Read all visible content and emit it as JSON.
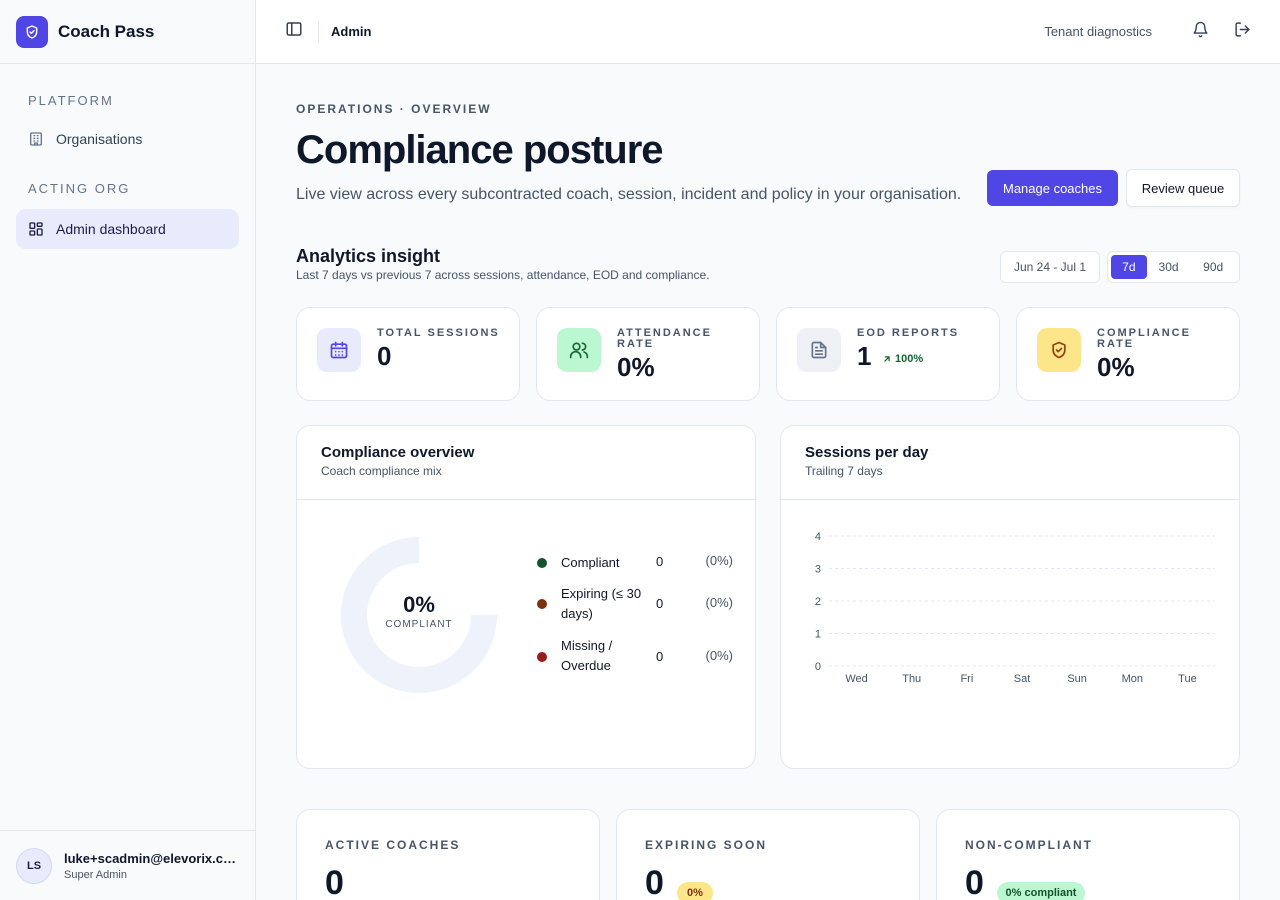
{
  "app": {
    "name": "Coach Pass"
  },
  "sidebar": {
    "platform_heading": "PLATFORM",
    "platform_items": [
      {
        "label": "Organisations",
        "icon": "building-icon"
      }
    ],
    "acting_org_heading": "ACTING ORG",
    "acting_org_items": [
      {
        "label": "Admin dashboard",
        "icon": "grid-icon",
        "active": true
      }
    ],
    "user": {
      "initials": "LS",
      "email": "luke+scadmin@elevorix.co.uk",
      "role": "Super Admin"
    }
  },
  "topbar": {
    "breadcrumb": "Admin",
    "diagnostics_link": "Tenant diagnostics"
  },
  "header": {
    "eyebrow": "OPERATIONS · OVERVIEW",
    "title": "Compliance posture",
    "subtitle": "Live view across every subcontracted coach, session, incident and policy in your organisation.",
    "primary_action": "Manage coaches",
    "secondary_action": "Review queue"
  },
  "analytics": {
    "title": "Analytics insight",
    "subtitle": "Last 7 days vs previous 7 across sessions, attendance, EOD and compliance.",
    "date_range": "Jun 24 - Jul 1",
    "ranges": [
      "7d",
      "30d",
      "90d"
    ],
    "selected_range": "7d"
  },
  "kpis": [
    {
      "label": "TOTAL SESSIONS",
      "value": "0",
      "icon": "calendar-icon",
      "icon_bg": "#e8ebfb",
      "icon_color": "#4f46e5"
    },
    {
      "label": "ATTENDANCE RATE",
      "value": "0%",
      "icon": "users-icon",
      "icon_bg": "#bbf7d0",
      "icon_color": "#166534"
    },
    {
      "label": "EOD REPORTS",
      "value": "1",
      "trend": "100%",
      "icon": "document-icon",
      "icon_bg": "#eef0f5",
      "icon_color": "#64748b"
    },
    {
      "label": "COMPLIANCE RATE",
      "value": "0%",
      "icon": "shield-check-icon",
      "icon_bg": "#fde68a",
      "icon_color": "#92400e"
    }
  ],
  "compliance_card": {
    "title": "Compliance overview",
    "subtitle": "Coach compliance mix",
    "center_value": "0%",
    "center_label": "COMPLIANT",
    "legend": [
      {
        "name": "Compliant",
        "count": "0",
        "pct": "(0%)",
        "color": "#14532d"
      },
      {
        "name": "Expiring (≤ 30 days)",
        "count": "0",
        "pct": "(0%)",
        "color": "#78350f"
      },
      {
        "name": "Missing / Overdue",
        "count": "0",
        "pct": "(0%)",
        "color": "#991b1b"
      }
    ]
  },
  "sessions_card": {
    "title": "Sessions per day",
    "subtitle": "Trailing 7 days"
  },
  "chart_data": {
    "type": "bar",
    "categories": [
      "Wed",
      "Thu",
      "Fri",
      "Sat",
      "Sun",
      "Mon",
      "Tue"
    ],
    "values": [
      0,
      0,
      0,
      0,
      0,
      0,
      0
    ],
    "y_ticks": [
      "0",
      "1",
      "2",
      "3",
      "4"
    ],
    "ylim": [
      0,
      4
    ],
    "grid": true
  },
  "stats": [
    {
      "label": "ACTIVE COACHES",
      "value": "0"
    },
    {
      "label": "EXPIRING SOON",
      "value": "0",
      "badge": "0%",
      "badge_bg": "#fde68a",
      "badge_color": "#78350f"
    },
    {
      "label": "NON-COMPLIANT",
      "value": "0",
      "badge": "0% compliant",
      "badge_bg": "#bbf7d0",
      "badge_color": "#14532d"
    }
  ]
}
